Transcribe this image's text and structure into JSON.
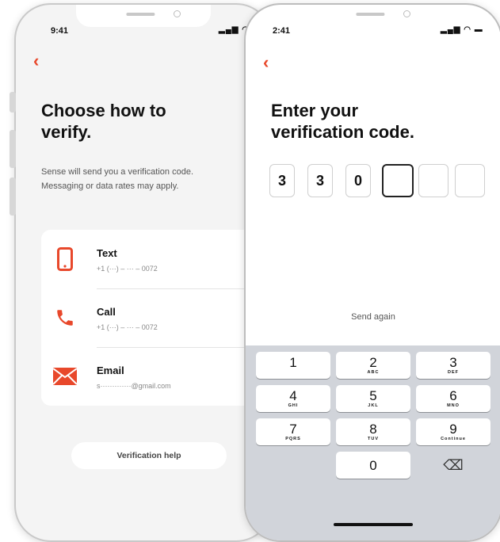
{
  "left_screen": {
    "time": "9:41",
    "status_icons": "▂▄▆ ◠",
    "back_glyph": "‹",
    "title_line1": "Choose how to",
    "title_line2": "verify.",
    "description_line1": "Sense will send you a verification code.",
    "description_line2": "Messaging or data rates may apply.",
    "options": [
      {
        "icon": "phone-icon",
        "title": "Text",
        "detail": "+1 (···) – ··· – 0072"
      },
      {
        "icon": "call-icon",
        "title": "Call",
        "detail": "+1 (···) – ··· – 0072"
      },
      {
        "icon": "email-icon",
        "title": "Email",
        "detail": "s·············@gmail.com"
      }
    ],
    "help_button": "Verification help"
  },
  "right_screen": {
    "time": "2:41",
    "status_icons": "▂▄▆ ◠ ▬",
    "back_glyph": "‹",
    "title_line1": "Enter your",
    "title_line2": "verification code.",
    "code_digits": [
      "3",
      "3",
      "0",
      "",
      "",
      ""
    ],
    "active_index": 3,
    "send_again": "Send again",
    "keys": [
      {
        "num": "1",
        "letters": ""
      },
      {
        "num": "2",
        "letters": "ABC"
      },
      {
        "num": "3",
        "letters": "DEF"
      },
      {
        "num": "4",
        "letters": "GHI"
      },
      {
        "num": "5",
        "letters": "JKL"
      },
      {
        "num": "6",
        "letters": "MNO"
      },
      {
        "num": "7",
        "letters": "PQRS"
      },
      {
        "num": "8",
        "letters": "TUV"
      },
      {
        "num": "9",
        "letters": "Continue"
      },
      {
        "num": "0",
        "letters": ""
      }
    ],
    "delete_glyph": "⌫"
  },
  "colors": {
    "accent": "#e8482b",
    "keypad_bg": "#d1d4da",
    "card_bg": "#ffffff"
  }
}
